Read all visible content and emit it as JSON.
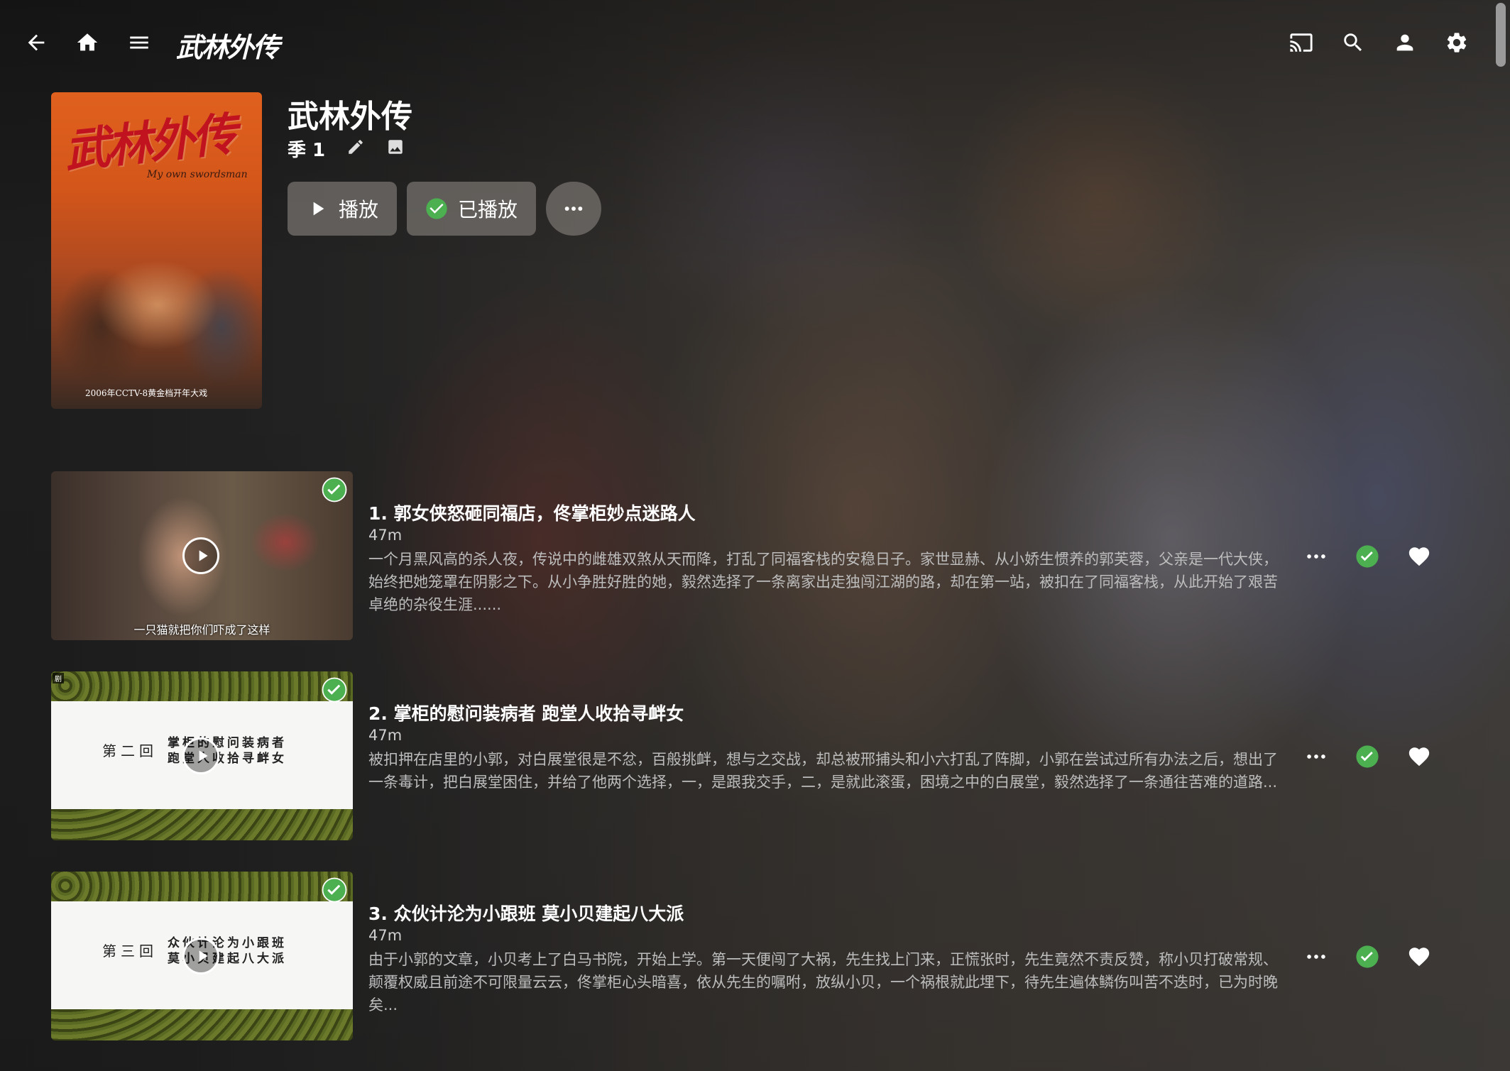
{
  "header": {
    "logo_text": "武林外传",
    "icons": [
      "arrow-back-icon",
      "home-icon",
      "menu-icon",
      "cast-icon",
      "search-icon",
      "person-icon",
      "settings-icon"
    ]
  },
  "show": {
    "poster": {
      "title": "武林外传",
      "subtitle": "My own swordsman",
      "caption": "2006年CCTV-8黄金档开年大戏"
    },
    "title": "武林外传",
    "season_label": "季 1",
    "play_label": "播放",
    "played_label": "已播放"
  },
  "colors": {
    "accent_green": "#4caf50",
    "button_bg": "#78746f"
  },
  "episodes": [
    {
      "title": "1. 郭女侠怒砸同福店，佟掌柜妙点迷路人",
      "duration": "47m",
      "description": "一个月黑风高的杀人夜，传说中的雌雄双煞从天而降，打乱了同福客栈的安稳日子。家世显赫、从小娇生惯养的郭芙蓉，父亲是一代大侠，始终把她笼罩在阴影之下。从小争胜好胜的她，毅然选择了一条离家出走独闯江湖的路，却在第一站，被扣在了同福客栈，从此开始了艰苦卓绝的杂役生涯......",
      "thumb_caption": "一只猫就把你们吓成了这样",
      "watched": true,
      "favorite": true
    },
    {
      "title": "2. 掌柜的慰问装病者 跑堂人收拾寻衅女",
      "duration": "47m",
      "description": "被扣押在店里的小郭，对白展堂很是不忿，百般挑衅，想与之交战，却总被邢捕头和小六打乱了阵脚，小郭在尝试过所有办法之后，想出了一条毒计，把白展堂困住，并给了他两个选择，一，是跟我交手，二，是就此滚蛋，困境之中的白展堂，毅然选择了一条通往苦难的道路...",
      "card_chapter": "第二回",
      "card_line1": "掌柜的慰问装病者",
      "card_line2": "跑堂人收拾寻衅女",
      "thumb_tag": "剧",
      "watched": true,
      "favorite": true
    },
    {
      "title": "3. 众伙计沦为小跟班 莫小贝建起八大派",
      "duration": "47m",
      "description": "由于小郭的文章，小贝考上了白马书院，开始上学。第一天便闯了大祸，先生找上门来，正慌张时，先生竟然不责反赞，称小贝打破常规、颠覆权威且前途不可限量云云，佟掌柜心头暗喜，依从先生的嘱咐，放纵小贝，一个祸根就此埋下，待先生遍体鳞伤叫苦不迭时，已为时晚矣...",
      "card_chapter": "第三回",
      "card_line1": "众伙计沦为小跟班",
      "card_line2": "莫小贝建起八大派",
      "watched": true,
      "favorite": true
    }
  ]
}
